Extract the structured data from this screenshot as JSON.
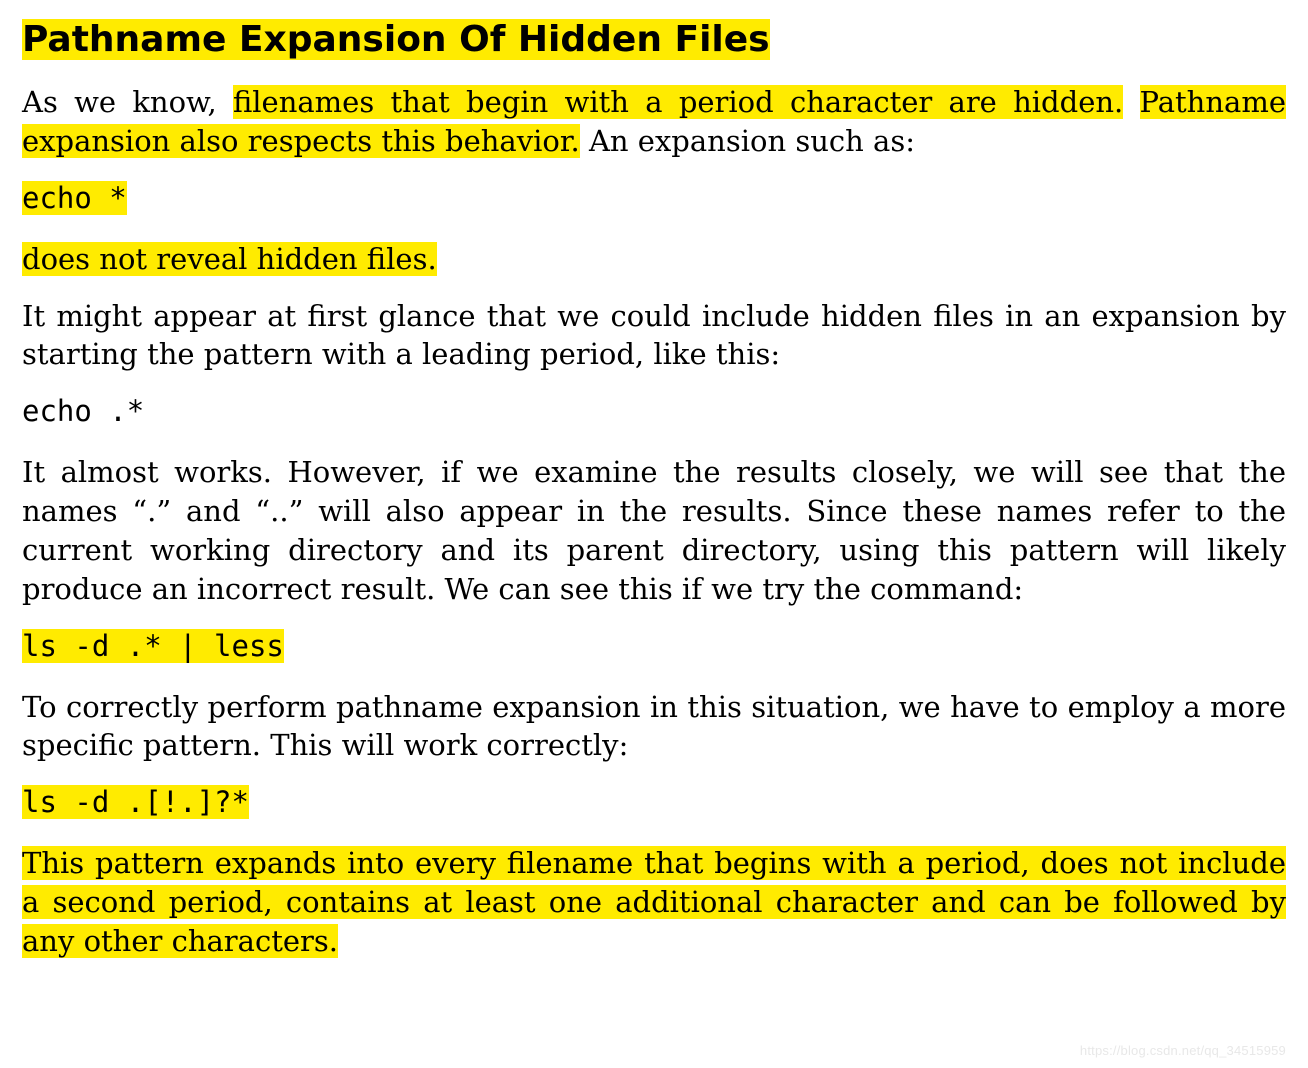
{
  "title": "Pathname Expansion Of Hidden Files",
  "p1": {
    "a": "As we know, ",
    "b": "filenames that begin with a period character are hidden.",
    "c": "  ",
    "d": "Pathname expansion also respects this behavior.",
    "e": "  An expansion such as:"
  },
  "code1": "echo *",
  "p2": "does not reveal hidden files.",
  "p3": "It might appear at first glance that we could include hidden files in an expansion by starting the pattern with a leading period, like this:",
  "code2": "echo .*",
  "p4": "It almost works.  However, if we examine the results closely, we will see that the names “.” and “..” will also appear in the results.  Since these names refer to the current working directory and its parent directory, using this pattern will likely produce an incorrect result.  We can see this if we try the command:",
  "code3": "ls -d .* | less",
  "p5": "To correctly perform pathname expansion in this situation, we have to employ a more specific pattern.  This will work correctly:",
  "code4": "ls -d .[!.]?*",
  "p6": "This pattern expands into every filename that begins with a period, does not include a second period, contains at least one additional character and can be followed by any other characters.",
  "watermark": "https://blog.csdn.net/qq_34515959"
}
